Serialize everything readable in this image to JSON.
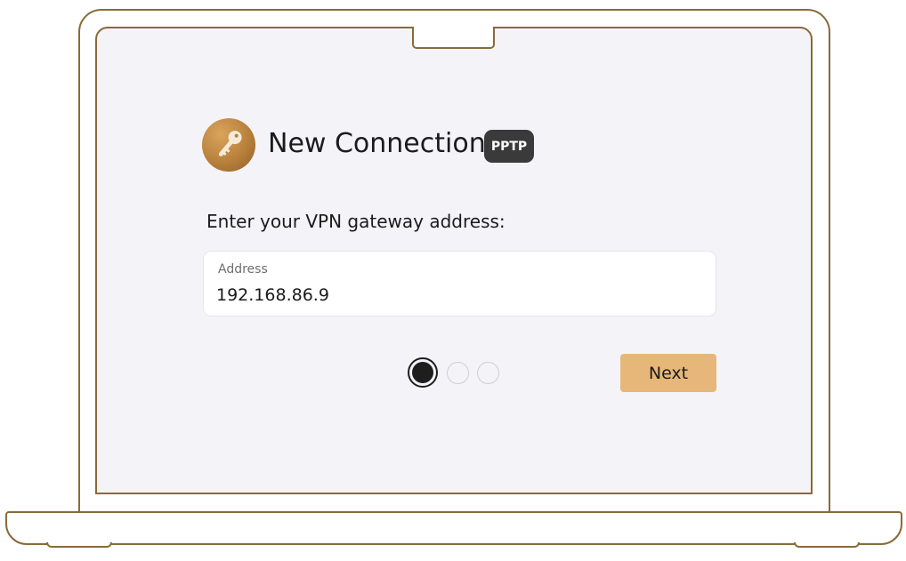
{
  "dialog": {
    "title": "New Connection",
    "badge": "PPTP",
    "prompt": "Enter your VPN gateway address:",
    "icon": "key-icon"
  },
  "address_field": {
    "label": "Address",
    "value": "192.168.86.9"
  },
  "pager": {
    "total_steps": 3,
    "current_step": 1
  },
  "actions": {
    "next_label": "Next"
  },
  "colors": {
    "accent": "#e7b779",
    "frame": "#8a6a3a",
    "badge_bg": "#3a3a3a",
    "screen_bg": "#f4f3f8"
  }
}
